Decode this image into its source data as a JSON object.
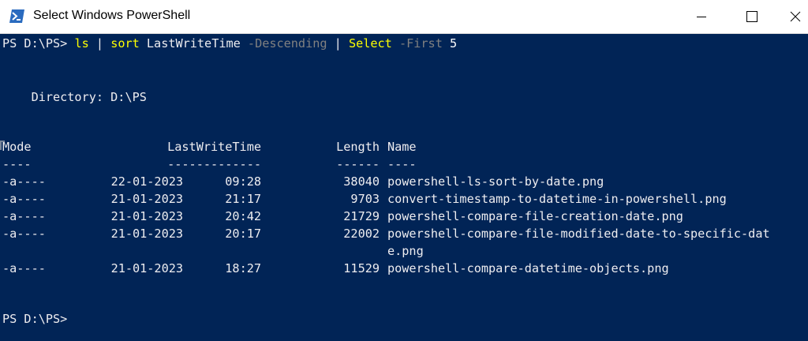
{
  "window": {
    "title": "Select Windows PowerShell",
    "icon": "powershell-icon",
    "controls": [
      "minimize-icon",
      "maximize-icon",
      "close-icon"
    ],
    "colors": {
      "background": "#012456",
      "text": "#eeedf0",
      "command": "#ffff00",
      "parameter": "#808080"
    }
  },
  "console": {
    "prompt": "PS D:\\PS>",
    "command": {
      "cmd1": "ls",
      "pipe1": " | ",
      "cmd2": "sort",
      "arg1": " LastWriteTime ",
      "param1": "-Descending",
      "pipe2": " | ",
      "cmd3": "Select",
      "param2": " -First",
      "num": " 5"
    },
    "directory_line": "    Directory: D:\\PS",
    "headers": {
      "mode": "Mode",
      "lastwritetime": "LastWriteTime",
      "length": "Length",
      "name": "Name"
    },
    "underlines": {
      "mode": "----",
      "lastwritetime": "-------------",
      "length": "------",
      "name": "----"
    },
    "rows": [
      {
        "mode": "-a----",
        "date": "22-01-2023",
        "time": "09:28",
        "length": "38040",
        "name": "powershell-ls-sort-by-date.png",
        "name_cont": ""
      },
      {
        "mode": "-a----",
        "date": "21-01-2023",
        "time": "21:17",
        "length": "9703",
        "name": "convert-timestamp-to-datetime-in-powershell.png",
        "name_cont": ""
      },
      {
        "mode": "-a----",
        "date": "21-01-2023",
        "time": "20:42",
        "length": "21729",
        "name": "powershell-compare-file-creation-date.png",
        "name_cont": ""
      },
      {
        "mode": "-a----",
        "date": "21-01-2023",
        "time": "20:17",
        "length": "22002",
        "name": "powershell-compare-file-modified-date-to-specific-dat",
        "name_cont": "e.png"
      },
      {
        "mode": "-a----",
        "date": "21-01-2023",
        "time": "18:27",
        "length": "11529",
        "name": "powershell-compare-datetime-objects.png",
        "name_cont": ""
      }
    ],
    "final_prompt": "PS D:\\PS>"
  }
}
